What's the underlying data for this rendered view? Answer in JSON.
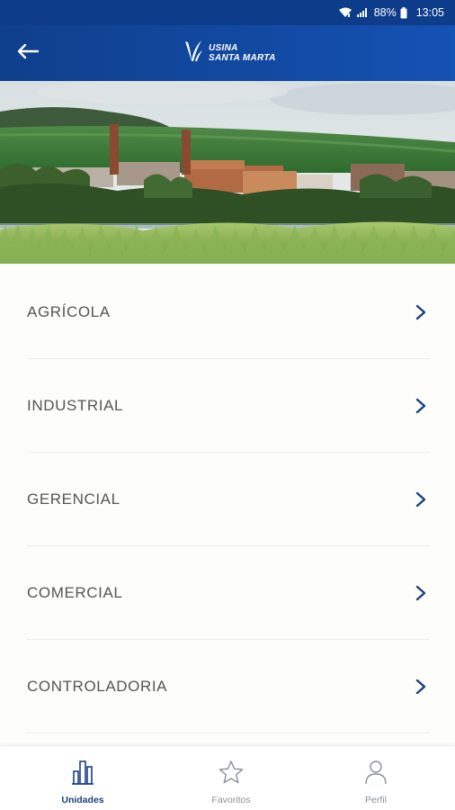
{
  "status_bar": {
    "battery_percent": "88%",
    "time": "13:05"
  },
  "header": {
    "brand_line_1": "USINA",
    "brand_line_2": "SANTA MARTA",
    "back_icon": "arrow-left-icon",
    "logo_icon": "usina-logo-icon"
  },
  "hero": {
    "image": "sugar-mill-landscape-photo"
  },
  "menu": {
    "items": [
      {
        "label": "AGRÍCOLA"
      },
      {
        "label": "INDUSTRIAL"
      },
      {
        "label": "GERENCIAL"
      },
      {
        "label": "COMERCIAL"
      },
      {
        "label": "CONTROLADORIA"
      }
    ]
  },
  "bottom_nav": {
    "tabs": [
      {
        "label": "Unidades",
        "icon": "buildings-icon",
        "active": true
      },
      {
        "label": "Favoritos",
        "icon": "star-icon",
        "active": false
      },
      {
        "label": "Perfil",
        "icon": "user-icon",
        "active": false
      }
    ]
  },
  "colors": {
    "primary": "#0f3f8c",
    "accent": "#1b3f80",
    "text": "#555555",
    "inactive": "#8a8f99"
  }
}
